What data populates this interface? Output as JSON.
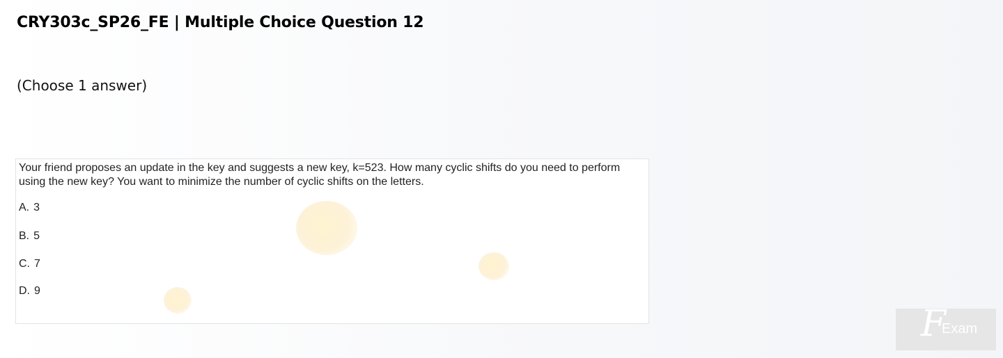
{
  "header": {
    "title": "CRY303c_SP26_FE | Multiple Choice Question 12",
    "instruction": "(Choose 1 answer)"
  },
  "question": {
    "text": "Your friend proposes an update in the key and suggests a new key, k=523. How many cyclic shifts do you need to perform using the new key? You want to minimize the number of cyclic shifts on the letters.",
    "options": [
      {
        "letter": "A.",
        "value": "3"
      },
      {
        "letter": "B.",
        "value": "5"
      },
      {
        "letter": "C.",
        "value": "7"
      },
      {
        "letter": "D.",
        "value": "9"
      }
    ]
  },
  "watermark": {
    "mark": "F",
    "text": "Exam"
  },
  "colors": {
    "watermark_bg": "#e6e6e6",
    "watermark_fg": "#ffffff",
    "blob": "#fdf0cc"
  }
}
